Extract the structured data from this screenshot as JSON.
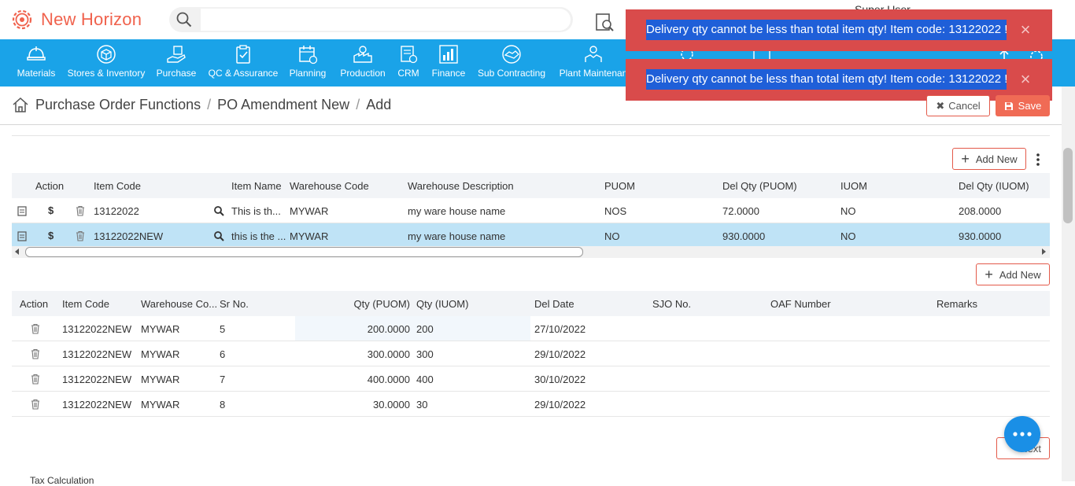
{
  "app": {
    "name": "New Horizon",
    "user": "Super User"
  },
  "search": {
    "placeholder": ""
  },
  "nav": [
    {
      "label": "Materials",
      "icon": "helmet-icon"
    },
    {
      "label": "Stores & Inventory",
      "icon": "box-icon"
    },
    {
      "label": "Purchase",
      "icon": "hand-cart-icon"
    },
    {
      "label": "QC & Assurance",
      "icon": "clipboard-check-icon"
    },
    {
      "label": "Planning",
      "icon": "calendar-icon"
    },
    {
      "label": "Production",
      "icon": "factory-icon"
    },
    {
      "label": "CRM",
      "icon": "crm-icon"
    },
    {
      "label": "Finance",
      "icon": "bar-chart-icon"
    },
    {
      "label": "Sub Contracting",
      "icon": "handshake-icon"
    },
    {
      "label": "Plant Maintenan",
      "icon": "maintenance-icon"
    }
  ],
  "toasts": [
    {
      "message": "Delivery qty cannot be less than total item qty! Item code: 13122022 !",
      "close": "×"
    },
    {
      "message": "Delivery qty cannot be less than total item qty! Item code: 13122022 !",
      "close": "×"
    }
  ],
  "breadcrumb": {
    "home": "Purchase Order Functions",
    "middle": "PO Amendment New",
    "current": "Add",
    "sep": "/"
  },
  "actions": {
    "cancel": "Cancel",
    "save": "Save"
  },
  "items_table": {
    "add_label": "Add New",
    "columns": [
      "Action",
      "Item Code",
      "Item Name",
      "Warehouse Code",
      "Warehouse Description",
      "PUOM",
      "Del Qty (PUOM)",
      "IUOM",
      "Del Qty (IUOM)"
    ],
    "rows": [
      {
        "item_code": "13122022",
        "item_name": "This is th...",
        "wh_code": "MYWAR",
        "wh_desc": "my ware house name",
        "puom": "NOS",
        "del_qty_puom": "72.0000",
        "iuom": "NO",
        "del_qty_iuom": "208.0000",
        "selected": false
      },
      {
        "item_code": "13122022NEW",
        "item_name": "this is the ...",
        "wh_code": "MYWAR",
        "wh_desc": "my ware house name",
        "puom": "NO",
        "del_qty_puom": "930.0000",
        "iuom": "NO",
        "del_qty_iuom": "930.0000",
        "selected": true
      }
    ]
  },
  "schedule_table": {
    "add_label": "Add New",
    "columns": [
      "Action",
      "Item Code",
      "Warehouse Co...",
      "Sr No.",
      "Qty (PUOM)",
      "Qty (IUOM)",
      "Del Date",
      "SJO No.",
      "OAF Number",
      "Remarks"
    ],
    "rows": [
      {
        "item_code": "13122022NEW",
        "wh_code": "MYWAR",
        "sr_no": "5",
        "qty_puom": "200.0000",
        "qty_iuom": "200",
        "del_date": "27/10/2022"
      },
      {
        "item_code": "13122022NEW",
        "wh_code": "MYWAR",
        "sr_no": "6",
        "qty_puom": "300.0000",
        "qty_iuom": "300",
        "del_date": "29/10/2022"
      },
      {
        "item_code": "13122022NEW",
        "wh_code": "MYWAR",
        "sr_no": "7",
        "qty_puom": "400.0000",
        "qty_iuom": "400",
        "del_date": "30/10/2022"
      },
      {
        "item_code": "13122022NEW",
        "wh_code": "MYWAR",
        "sr_no": "8",
        "qty_puom": "30.0000",
        "qty_iuom": "30",
        "del_date": "29/10/2022"
      }
    ]
  },
  "footer": {
    "next_label": "Next",
    "partial_text": "Tax Calculation"
  },
  "colors": {
    "brand": "#f0624d",
    "nav": "#1aa3e8",
    "toast": "#d94b4b",
    "selected_row": "#bfe3f6"
  }
}
